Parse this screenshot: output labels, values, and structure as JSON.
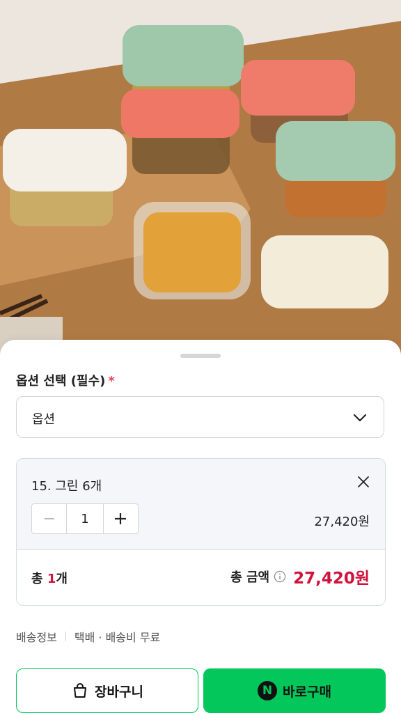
{
  "product_image": {
    "alt": "glass food storage containers",
    "icon": "product-photo"
  },
  "options": {
    "title": "옵션 선택 (필수)",
    "required_mark": "*",
    "select_value": "옵션"
  },
  "selected_item": {
    "name": "15. 그린 6개",
    "quantity": "1",
    "price": "27,420원"
  },
  "totals": {
    "count_prefix": "총 ",
    "count_value": "1",
    "count_suffix": "개",
    "amount_label": "총 금액",
    "amount": "27,420원"
  },
  "shipping": {
    "label": "배송정보",
    "value": "택배 · 배송비 무료"
  },
  "buttons": {
    "cart": "장바구니",
    "buy": "바로구매",
    "buy_logo": "N"
  },
  "colors": {
    "accent": "#03c75a",
    "price_red": "#d0133c",
    "required_red": "#e8424f"
  }
}
